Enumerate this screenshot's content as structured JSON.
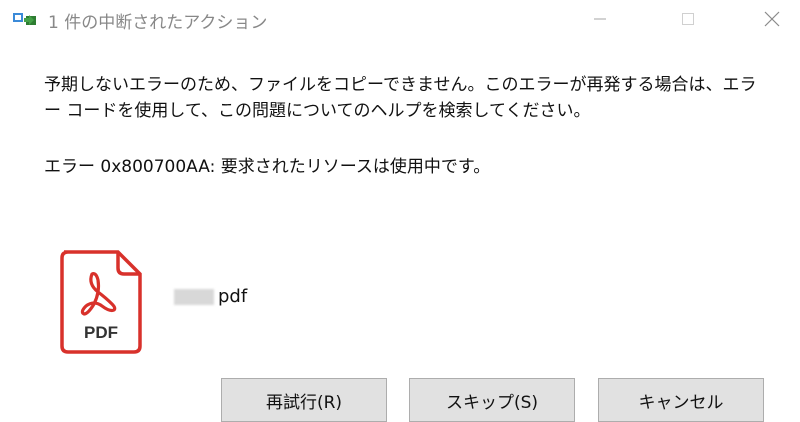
{
  "window": {
    "title": "1 件の中断されたアクション"
  },
  "message": {
    "line1": "予期しないエラーのため、ファイルをコピーできません。このエラーが再発する場合は、エラ",
    "line2": "ー コードを使用して、この問題についてのヘルプを検索してください。",
    "error": "エラー 0x800700AA: 要求されたリソースは使用中です。"
  },
  "file": {
    "icon_label": "PDF",
    "name": "pdf"
  },
  "buttons": {
    "retry": "再試行(R)",
    "skip": "スキップ(S)",
    "cancel": "キャンセル"
  },
  "icons": {
    "app": "copy-action-icon",
    "minimize": "minimize-icon",
    "maximize": "maximize-icon",
    "close": "close-icon",
    "file": "pdf-file-icon"
  },
  "colors": {
    "pdf_accent": "#d8312b",
    "button_bg": "#e1e1e1",
    "title_text": "#888888"
  }
}
